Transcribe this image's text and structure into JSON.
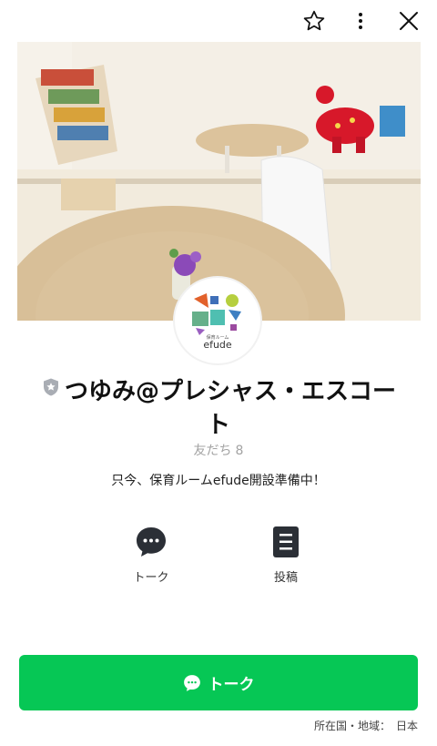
{
  "header": {
    "favorite_icon": "star-outline-icon",
    "menu_icon": "more-vertical-icon",
    "close_icon": "close-icon"
  },
  "profile": {
    "name": "つゆみ@プレシャス・エスコート",
    "logo_text": "efude",
    "logo_subtext": "保育ルーム",
    "friends_label": "友だち",
    "friends_count": "8",
    "status_message": "只今、保育ルームefude開設準備中！"
  },
  "actions": [
    {
      "label": "トーク",
      "icon": "chat-bubble-icon"
    },
    {
      "label": "投稿",
      "icon": "document-icon"
    }
  ],
  "primary_button": {
    "label": "トーク",
    "icon": "chat-bubble-icon",
    "color": "#06c755"
  },
  "footer": {
    "region_label": "所在国・地域：",
    "region_value": "日本"
  }
}
